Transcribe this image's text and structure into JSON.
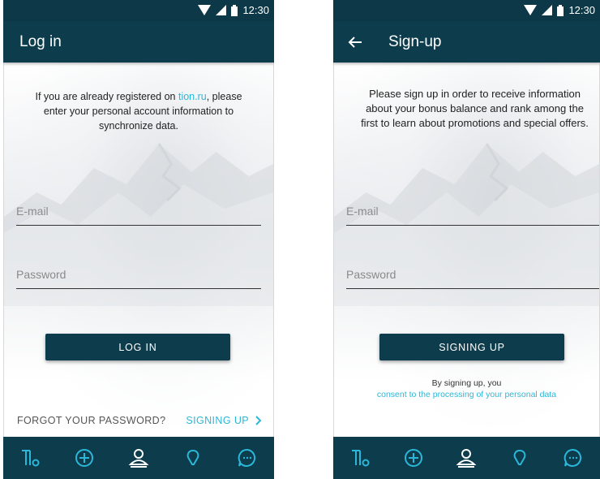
{
  "status_bar": {
    "time": "12:30"
  },
  "login": {
    "title": "Log in",
    "intro_before": "If you are already registered on ",
    "intro_link": "tion.ru",
    "intro_after": ",  please enter your personal account information to synchronize data.",
    "email_placeholder": "E-mail",
    "password_placeholder": "Password",
    "login_button": "LOG IN",
    "forgot_password": "FORGOT YOUR PASSWORD?",
    "signup_link": "SIGNING UP"
  },
  "signup": {
    "title": "Sign-up",
    "intro": "Please sign up in order to receive information about your bonus balance and rank among the first to learn about promotions and special offers.",
    "email_placeholder": "E-mail",
    "password_placeholder": "Password",
    "signup_button": "SIGNING UP",
    "consent_line1": "By signing up, you",
    "consent_link": "consent to the processing of your personal data"
  },
  "tabbar": {
    "icons": [
      "tion-logo-icon",
      "add-circle-icon",
      "user-icon",
      "lightbulb-icon",
      "chat-icon"
    ],
    "active_index": 2
  },
  "colors": {
    "primary": "#0d3c4c",
    "accent": "#2bb7d8"
  }
}
